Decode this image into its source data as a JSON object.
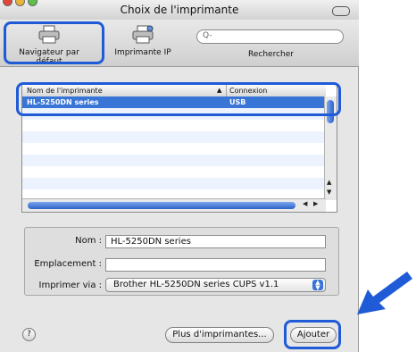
{
  "window": {
    "title": "Choix de l'imprimante"
  },
  "toolbar": {
    "default_browser": "Navigateur par défaut",
    "ip_printer": "Imprimante IP",
    "search_label": "Rechercher",
    "search_placeholder": "Q-"
  },
  "list": {
    "col_name": "Nom de l'imprimante",
    "col_connection": "Connexion",
    "rows": [
      {
        "name": "HL-5250DN series",
        "connection": "USB",
        "selected": true
      }
    ]
  },
  "form": {
    "name_label": "Nom :",
    "name_value": "HL-5250DN series",
    "location_label": "Emplacement :",
    "location_value": "",
    "print_via_label": "Imprimer via :",
    "print_via_value": "Brother HL-5250DN series CUPS v1.1"
  },
  "buttons": {
    "help": "?",
    "more_printers": "Plus d'imprimantes...",
    "add": "Ajouter"
  },
  "colors": {
    "highlight": "#1f5bd6",
    "selection": "#3975d7",
    "arrow": "#1f5bd6"
  }
}
